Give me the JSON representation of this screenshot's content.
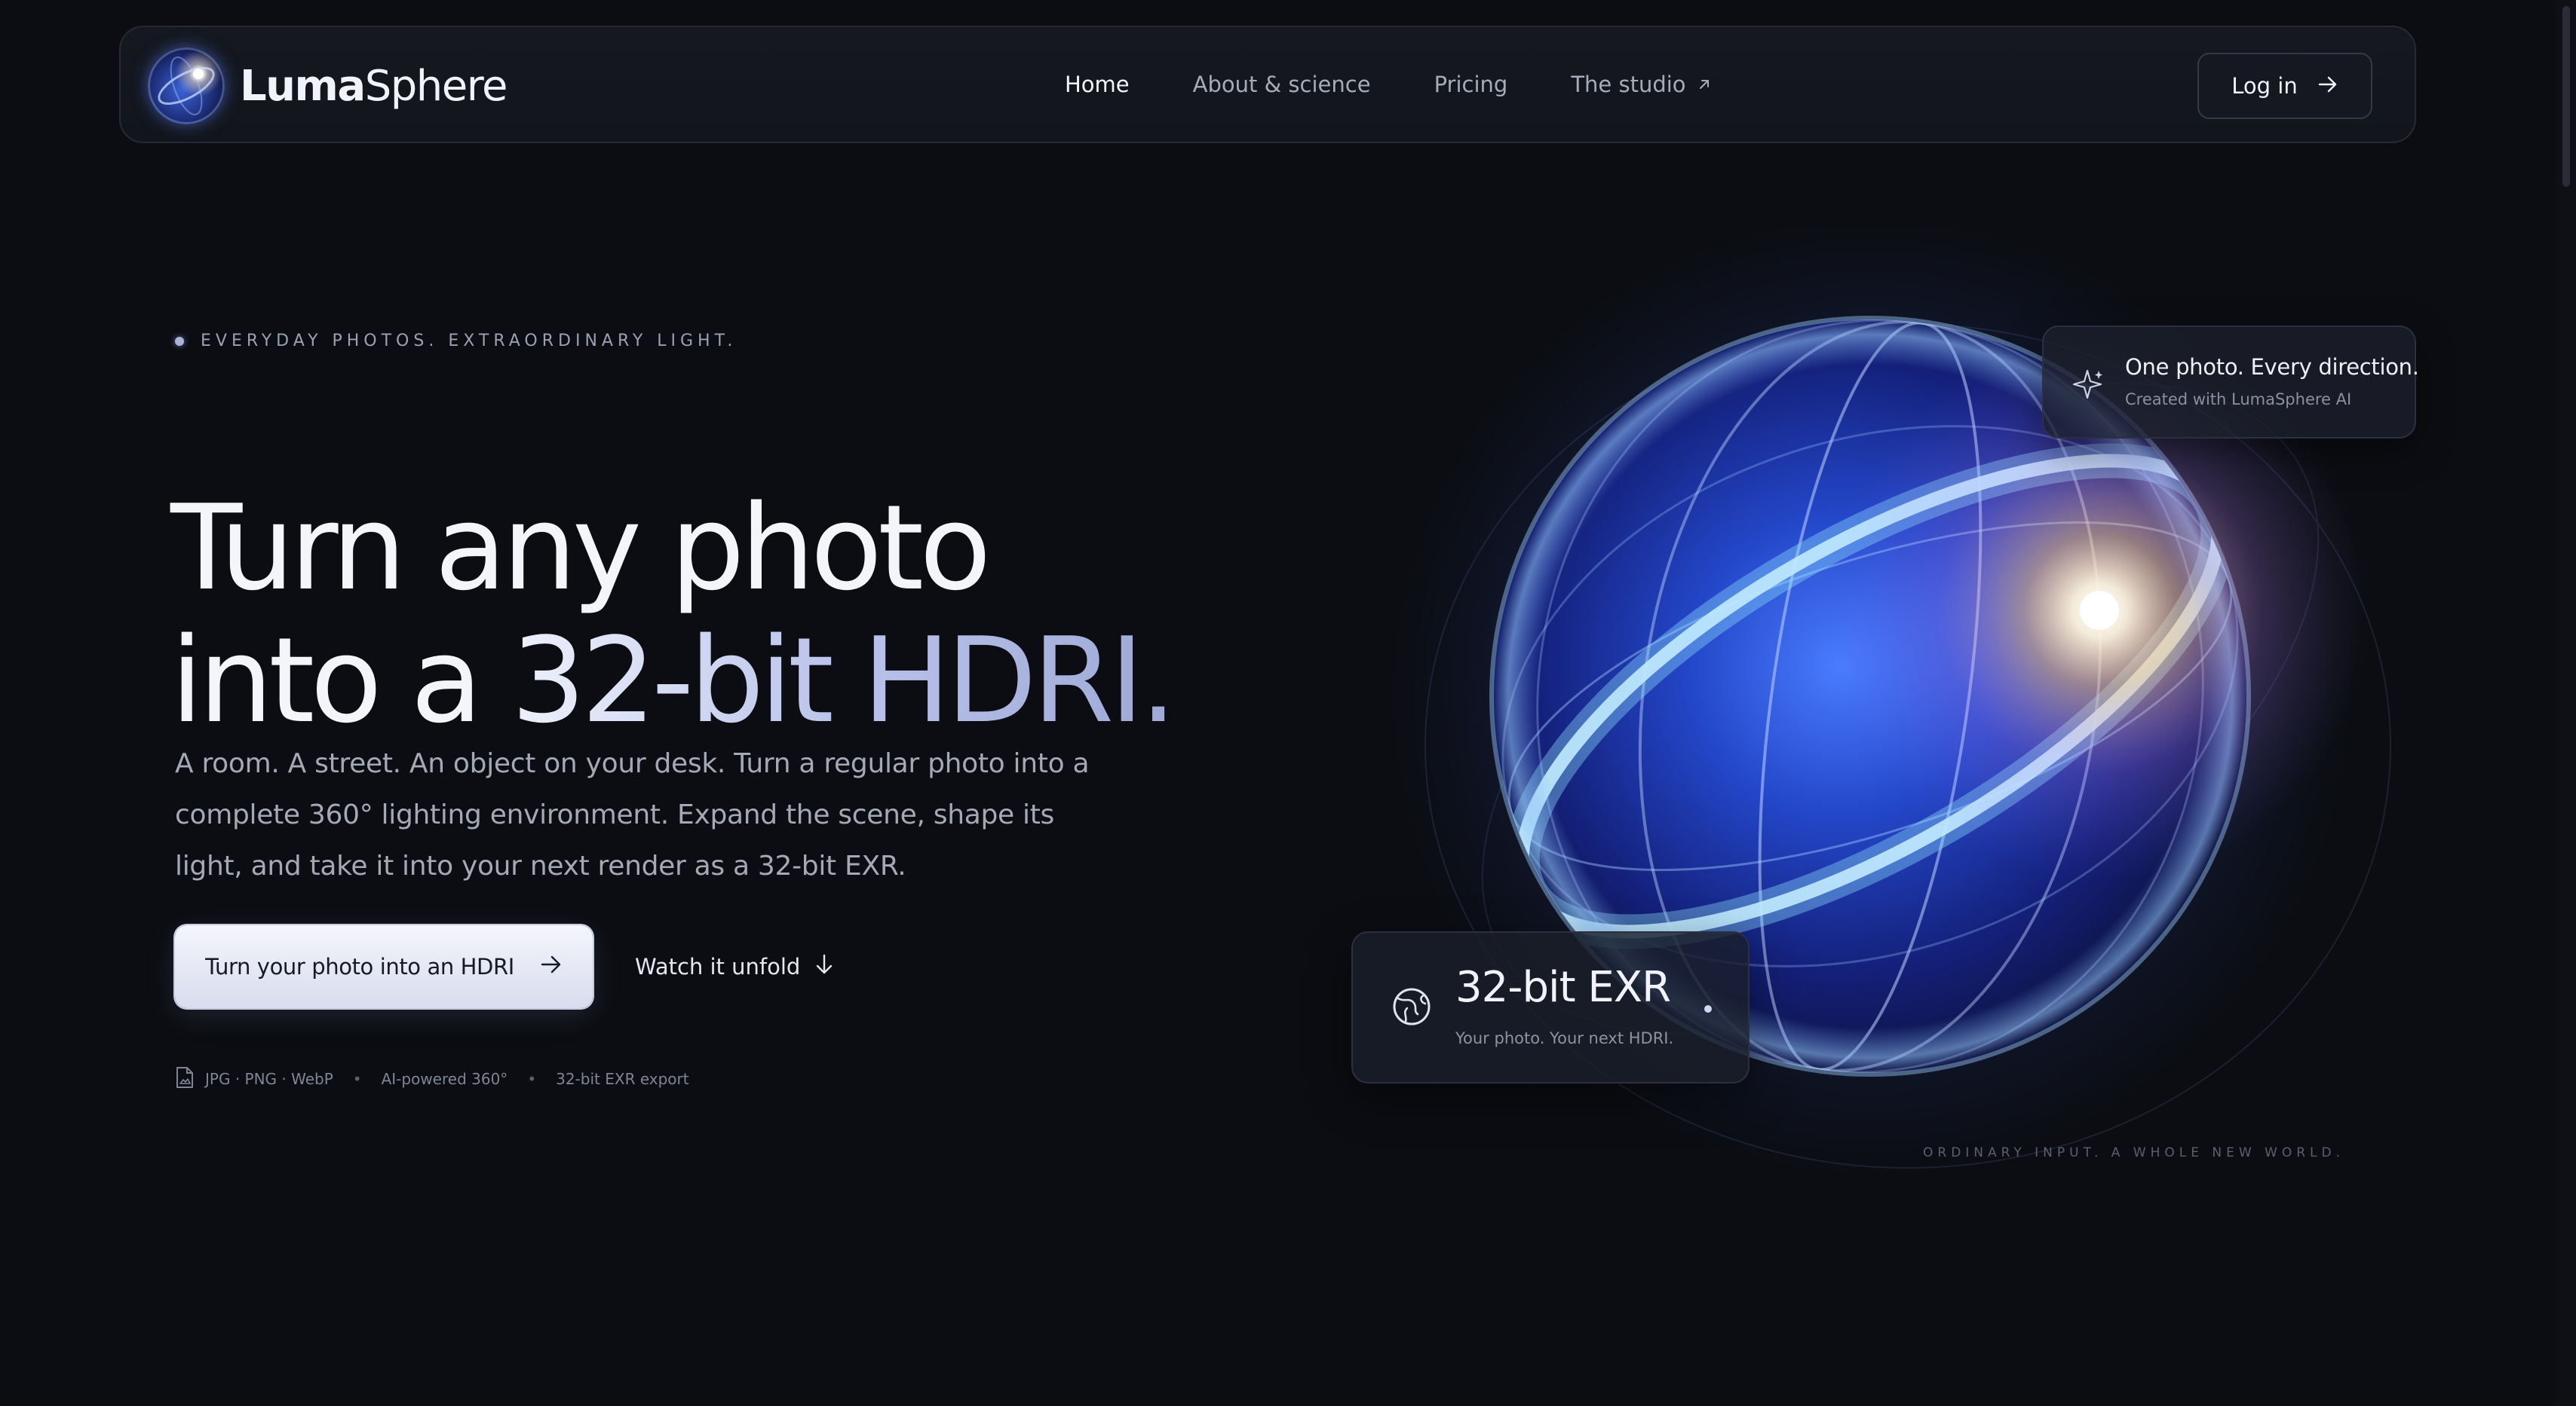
{
  "brand": {
    "name_bold": "Luma",
    "name_light": "Sphere"
  },
  "nav": {
    "links": [
      {
        "label": "Home",
        "active": true
      },
      {
        "label": "About & science",
        "active": false
      },
      {
        "label": "Pricing",
        "active": false
      },
      {
        "label": "The studio",
        "active": false,
        "icon": "external-link-icon"
      }
    ],
    "login_label": "Log in",
    "login_icon": "arrow-right-icon"
  },
  "hero": {
    "eyebrow": "EVERYDAY PHOTOS. EXTRAORDINARY LIGHT.",
    "headline_line1": "Turn any photo",
    "headline_line2_plain": "into a ",
    "headline_line2_accent": "32-bit HDRI.",
    "lede": "A room. A street. An object on your desk. Turn a regular photo into a complete 360° lighting environment. Expand the scene, shape its light, and take it into your next render as a 32-bit EXR.",
    "cta_primary": "Turn your photo into an HDRI",
    "cta_secondary": "Watch it unfold",
    "features": [
      "JPG · PNG · WebP",
      "AI-powered 360°",
      "32-bit EXR export"
    ]
  },
  "visual": {
    "badge_title": "One photo. Every direction.",
    "badge_sub": "Created with LumaSphere AI",
    "badge_icon": "sparkle-icon",
    "exr_title": "32-bit EXR",
    "exr_sub": "Your photo. Your next HDRI.",
    "exr_icon": "globe-icon",
    "tagline": "ORDINARY INPUT. A WHOLE NEW WORLD."
  },
  "colors": {
    "background": "#0b0d12",
    "accent_text": "#b9c3ea",
    "primary_button": "#e6e9f4",
    "sphere_blue": "#2f5ff0",
    "flare": "#ffd8a0"
  }
}
